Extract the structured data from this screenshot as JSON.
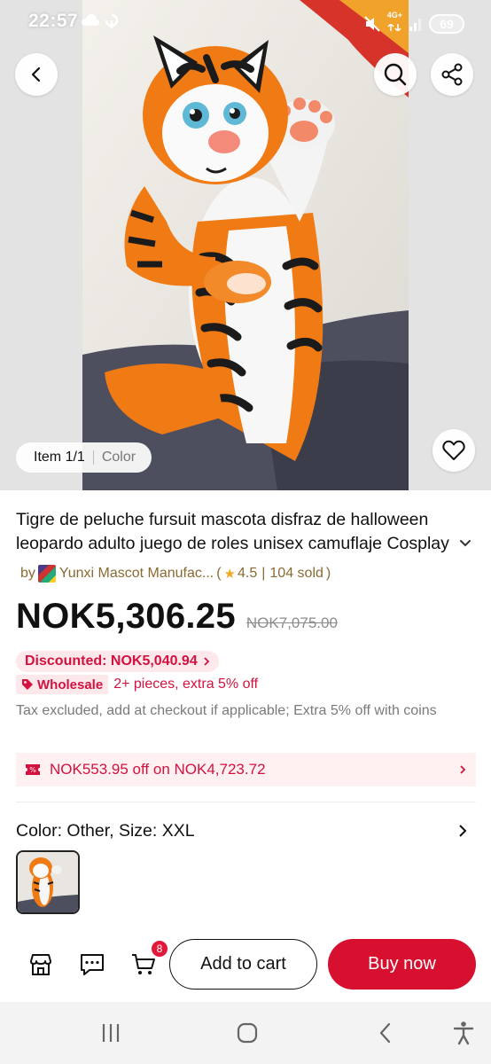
{
  "status_bar": {
    "time": "22:57",
    "network": "4G+",
    "battery": "69"
  },
  "gallery": {
    "item_counter": "Item 1/1",
    "color_tab": "Color"
  },
  "product": {
    "title": "Tigre de peluche fursuit mascota disfraz de halloween leopardo adulto juego de roles unisex camuflaje Cosplay",
    "seller_prefix": "by",
    "seller_name": "Yunxi Mascot Manufac...",
    "rating": "4.5",
    "sold": "104 sold",
    "price": "NOK5,306.25",
    "original_price": "NOK7,075.00",
    "discount_label": "Discounted: NOK5,040.94",
    "wholesale_badge": "Wholesale",
    "wholesale_text": "2+ pieces, extra 5% off",
    "tax_note": "Tax excluded, add at checkout if applicable; Extra 5% off with coins",
    "coupon_text": "NOK553.95 off on NOK4,723.72",
    "variant_label": "Color: Other, Size: XXL"
  },
  "action_bar": {
    "cart_count": "8",
    "add_to_cart": "Add to cart",
    "buy_now": "Buy now"
  },
  "colors": {
    "accent_red": "#d7102f",
    "discount_red": "#d3123f",
    "seller_gold": "#8a6a33"
  }
}
